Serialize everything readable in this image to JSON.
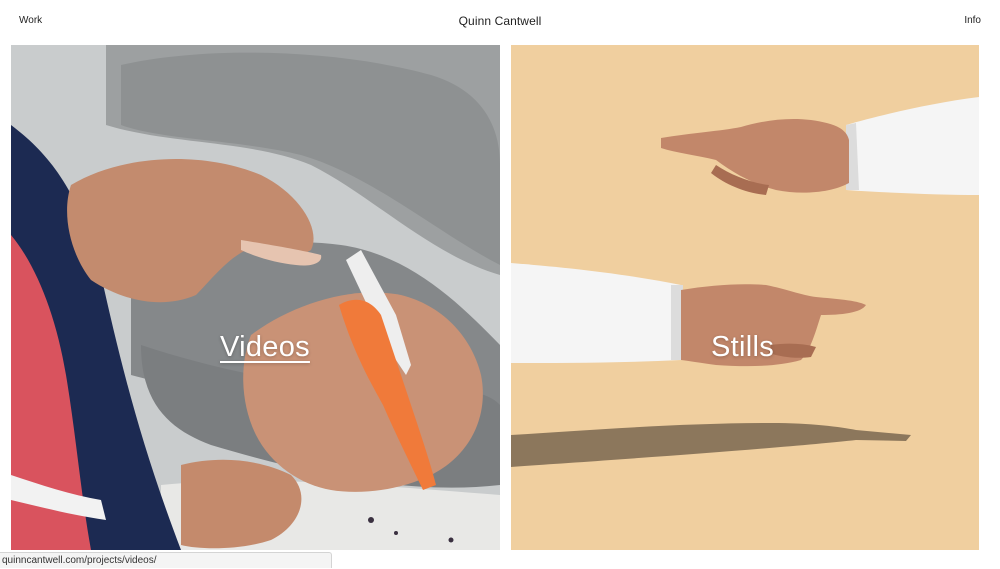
{
  "header": {
    "nav_left": "Work",
    "title": "Quinn Cantwell",
    "nav_right": "Info"
  },
  "panels": [
    {
      "label": "Videos",
      "image": "hands-cutting-fabric-with-orange-scissors"
    },
    {
      "label": "Stills",
      "image": "two-hands-pointing-on-beige-background"
    }
  ],
  "status_bar": {
    "url": "quinncantwell.com/projects/videos/"
  },
  "colors": {
    "background": "#ffffff",
    "stills_background": "#f0cf9f",
    "text": "#222222",
    "label": "#ffffff"
  }
}
